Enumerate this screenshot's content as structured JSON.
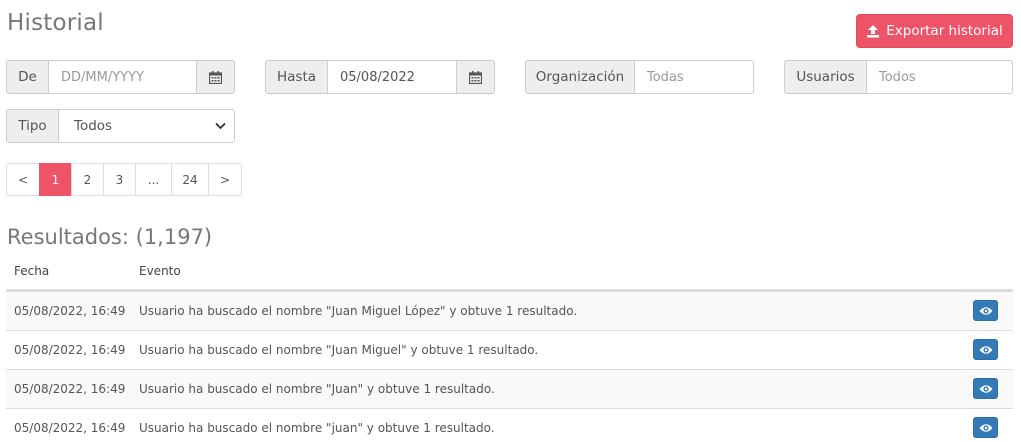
{
  "header": {
    "title": "Historial",
    "export_label": "Exportar historial",
    "export_icon": "upload-icon",
    "accent_color": "#ee5468"
  },
  "filters": {
    "from": {
      "label": "De",
      "placeholder": "DD/MM/YYYY",
      "value": "",
      "icon": "calendar-icon"
    },
    "to": {
      "label": "Hasta",
      "value": "05/08/2022",
      "icon": "calendar-icon"
    },
    "organization": {
      "label": "Organización",
      "placeholder": "Todas"
    },
    "users": {
      "label": "Usuarios",
      "placeholder": "Todos"
    },
    "type": {
      "label": "Tipo",
      "selected": "Todos"
    }
  },
  "pagination": {
    "prev": "<",
    "pages": [
      "1",
      "2",
      "3",
      "...",
      "24"
    ],
    "active_page": "1",
    "next": ">"
  },
  "results": {
    "label": "Resultados: (1,197)"
  },
  "table": {
    "columns": [
      "Fecha",
      "Evento"
    ],
    "rows": [
      {
        "date": "05/08/2022, 16:49",
        "event": "Usuario ha buscado el nombre \"Juan Miguel López\" y obtuve 1 resultado."
      },
      {
        "date": "05/08/2022, 16:49",
        "event": "Usuario ha buscado el nombre \"Juan Miguel\" y obtuve 1 resultado."
      },
      {
        "date": "05/08/2022, 16:49",
        "event": "Usuario ha buscado el nombre \"Juan\" y obtuve 1 resultado."
      },
      {
        "date": "05/08/2022, 16:49",
        "event": "Usuario ha buscado el nombre \"juan\" y obtuve 1 resultado."
      }
    ],
    "row_action_icon": "eye-icon",
    "action_color": "#337ab7"
  }
}
